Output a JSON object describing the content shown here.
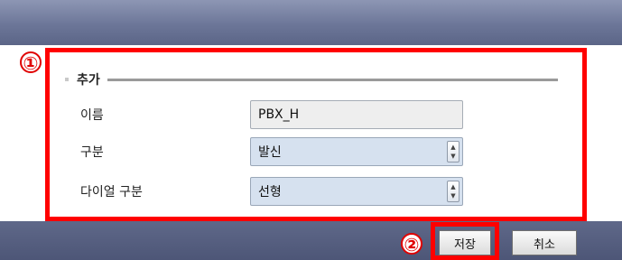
{
  "dialog": {
    "markers": {
      "one": "①",
      "two": "②"
    },
    "section_title": "추가",
    "fields": [
      {
        "label": "이름",
        "value": "PBX_H"
      },
      {
        "label": "구분",
        "value": "발신"
      },
      {
        "label": "다이얼 구분",
        "value": "선형"
      }
    ],
    "buttons": {
      "save": "저장",
      "cancel": "취소"
    }
  },
  "icons": {
    "spinner_up": "▲",
    "spinner_down": "▼"
  },
  "colors": {
    "title_bar": "#6c7698",
    "footer_bar": "#4d5677",
    "annotation_red": "#ff0000",
    "select_bg": "#d6e1ef"
  }
}
